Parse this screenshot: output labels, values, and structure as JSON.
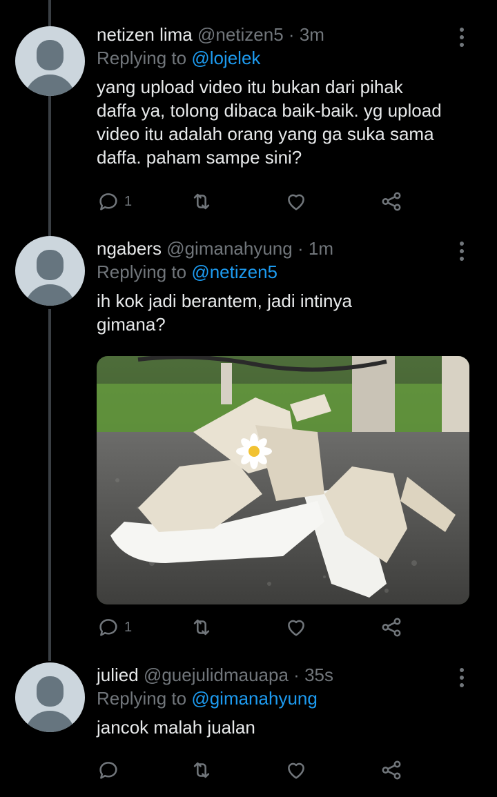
{
  "tweets": [
    {
      "display_name": "netizen lima",
      "handle": "@netizen5",
      "time": "3m",
      "replying_label": "Replying to",
      "replying_to": "@lojelek",
      "text": "yang upload video itu bukan dari pihak daffa ya, tolong dibaca baik-baik. yg upload video itu adalah orang yang ga suka sama daffa. paham sampe sini?",
      "reply_count": "1"
    },
    {
      "display_name": "ngabers",
      "handle": "@gimanahyung",
      "time": "1m",
      "replying_label": "Replying to",
      "replying_to": "@netizen5",
      "text": "ih kok jadi berantem, jadi intinya gimana?",
      "reply_count": "1"
    },
    {
      "display_name": "julied",
      "handle": "@guejulidmauapa",
      "time": "35s",
      "replying_label": "Replying to",
      "replying_to": "@gimanahyung",
      "text": "jancok malah jualan",
      "reply_count": ""
    }
  ],
  "separator": "·",
  "icons": {
    "reply": "reply-icon",
    "retweet": "retweet-icon",
    "like": "heart-icon",
    "share": "share-icon",
    "more": "more-vertical-icon"
  },
  "colors": {
    "background": "#000000",
    "text": "#e7e9ea",
    "muted": "#71767b",
    "link": "#1d9bf0",
    "thread_line": "#3a3f44"
  }
}
